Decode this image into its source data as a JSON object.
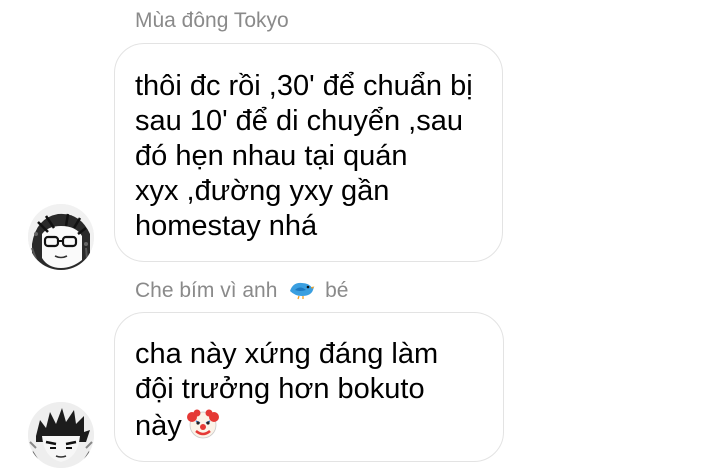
{
  "messages": [
    {
      "sender": "Mùa đông Tokyo",
      "lines": [
        "thôi đc rồi ,30' để chuẩn bị",
        "sau 10' để di chuyển ,sau",
        "đó hẹn nhau tại quán",
        "xyx ,đường yxy gần",
        "homestay nhá"
      ],
      "avatar_icon": "manga-glasses-avatar"
    },
    {
      "sender_prefix": "Che bím vì anh",
      "sender_icon": "blue-bird-icon",
      "sender_suffix": "bé",
      "lines": [
        "cha này xứng đáng làm",
        "đội trưởng hơn bokuto",
        "này"
      ],
      "trailing_emoji": "clown-face-icon",
      "avatar_icon": "manga-spiky-hair-avatar"
    }
  ]
}
